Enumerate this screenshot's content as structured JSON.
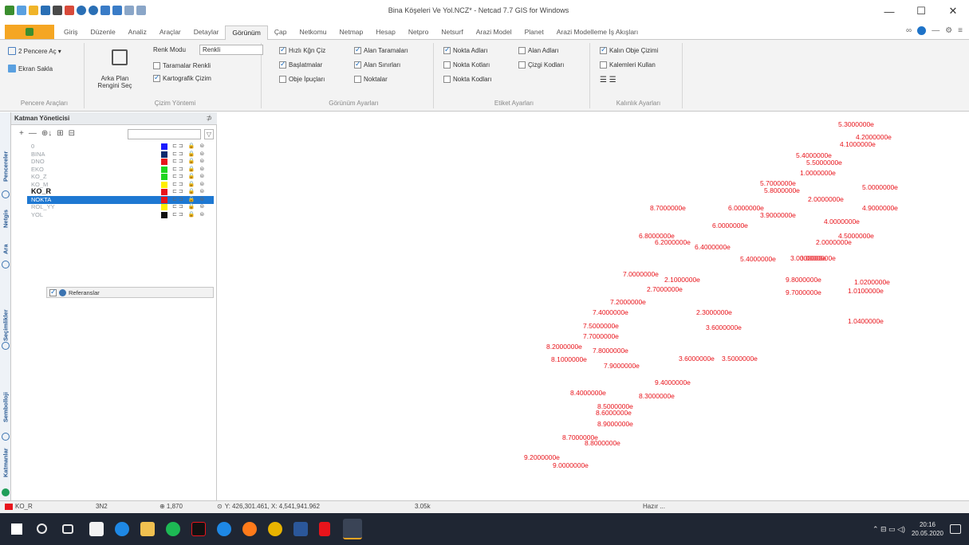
{
  "window": {
    "title": "Bina Köşeleri Ve Yol.NCZ* - Netcad 7.7 GIS for Windows",
    "minimize": "—",
    "maximize": "☐",
    "close": "✕"
  },
  "tabs": [
    "Giriş",
    "Düzenle",
    "Analiz",
    "Araçlar",
    "Detaylar",
    "Görünüm",
    "Çap",
    "Netkomu",
    "Netmap",
    "Hesap",
    "Netpro",
    "Netsurf",
    "Arazi Model",
    "Planet",
    "Arazi Modelleme İş Akışları"
  ],
  "active_tab": "Görünüm",
  "ribbon": {
    "pencere": {
      "label": "Pencere Araçları",
      "ikipencere": "2 Pencere Aç ▾",
      "ekransakla": "Ekran Sakla"
    },
    "cizim": {
      "label": "Çizim Yöntemi",
      "arkaplan": "Arka Plan Rengini Seç",
      "renkmodu_label": "Renk Modu",
      "renkmodu_value": "Renkli",
      "taramalar": "Taramalar Renkli",
      "kartografik": "Kartografik Çizim"
    },
    "gorunum": {
      "label": "Görünüm Ayarları",
      "hizli": "Hızlı Kğn Çiz",
      "baslatmalar": "Başlatmalar",
      "obje": "Obje İpuçları",
      "alantaramalari": "Alan Taramaları",
      "alansinirlari": "Alan Sınırları",
      "noktalar": "Noktalar"
    },
    "etiket": {
      "label": "Etiket Ayarları",
      "noktaadlari": "Nokta Adları",
      "noktakotlari": "Nokta Kotları",
      "noktakodlari": "Nokta Kodları",
      "alanadlari": "Alan Adları",
      "cizgikodlari": "Çizgi Kodları"
    },
    "kalinlik": {
      "label": "Kalınlık Ayarları",
      "kalinobje": "Kalın Obje Çizimi",
      "kalemleri": "Kalemleri Kullan",
      "icons": "☰ ☰"
    }
  },
  "layers_panel": {
    "title": "Katman Yöneticisi",
    "pin": "⊅",
    "filter": "▽",
    "toolbar": [
      "+",
      "—",
      "⊕↓",
      "⊞",
      "⊟"
    ],
    "layers": [
      {
        "name": "0",
        "color": "#1a1aff",
        "style": "normal"
      },
      {
        "name": "BINA",
        "color": "#0a2a6e",
        "style": "normal"
      },
      {
        "name": "DNO",
        "color": "#e8141b",
        "style": "normal"
      },
      {
        "name": "EKO",
        "color": "#1fd61f",
        "style": "normal"
      },
      {
        "name": "KO_Z",
        "color": "#1fd61f",
        "style": "normal"
      },
      {
        "name": "KO_M",
        "color": "#ffee00",
        "style": "normal"
      },
      {
        "name": "KO_R",
        "color": "#e8141b",
        "style": "bold"
      },
      {
        "name": "NOKTA",
        "color": "#e8141b",
        "style": "selected"
      },
      {
        "name": "ROL_YY",
        "color": "#ffee00",
        "style": "normal"
      },
      {
        "name": "YOL",
        "color": "#111111",
        "style": "normal"
      }
    ],
    "layer_flags": "⊏⊐ 🔒 ⊜",
    "reference": "Referanslar"
  },
  "side_tabs": [
    "Katmanlar",
    "Sembolloji",
    "Seçimlikler",
    "Ara",
    "Netgis",
    "Pencereler"
  ],
  "status": {
    "layer": "KO_R",
    "mode": "3N2",
    "scale": "⊕ 1,870",
    "coords": "Y: 426,301.461, X: 4,541,941.962",
    "zoom": "3.05k",
    "state": "Hazır ..."
  },
  "taskbar": {
    "time": "20:16",
    "date": "20.05.2020",
    "tray": "⌃  ⊟  ▭  ◁)"
  },
  "map_labels": [
    {
      "t": "5.3000000e"
    },
    {
      "t": "4.2000000e"
    },
    {
      "t": "4.1000000e"
    },
    {
      "t": "5.4000000e"
    },
    {
      "t": "5.5000000e"
    },
    {
      "t": "1.0000000e"
    },
    {
      "t": "5.7000000e"
    },
    {
      "t": "5.8000000e"
    },
    {
      "t": "5.0000000e"
    },
    {
      "t": "2.0000000e"
    },
    {
      "t": "8.7000000e"
    },
    {
      "t": "6.0000000e"
    },
    {
      "t": "4.9000000e"
    },
    {
      "t": "3.9000000e"
    },
    {
      "t": "6.0000000e"
    },
    {
      "t": "4.0000000e"
    },
    {
      "t": "6.8000000e"
    },
    {
      "t": "6.2000000e"
    },
    {
      "t": "2.0000000e"
    },
    {
      "t": "4.5000000e"
    },
    {
      "t": "6.4000000e"
    },
    {
      "t": "3.0000000e"
    },
    {
      "t": "5.4000000e"
    },
    {
      "t": "3.0000000e"
    },
    {
      "t": "7.0000000e"
    },
    {
      "t": "2.1000000e"
    },
    {
      "t": "9.8000000e"
    },
    {
      "t": "1.0200000e"
    },
    {
      "t": "2.7000000e"
    },
    {
      "t": "9.7000000e"
    },
    {
      "t": "1.0100000e"
    },
    {
      "t": "7.2000000e"
    },
    {
      "t": "7.4000000e"
    },
    {
      "t": "2.3000000e"
    },
    {
      "t": "1.0400000e"
    },
    {
      "t": "7.5000000e"
    },
    {
      "t": "3.6000000e"
    },
    {
      "t": "7.7000000e"
    },
    {
      "t": "8.2000000e"
    },
    {
      "t": "7.8000000e"
    },
    {
      "t": "8.1000000e"
    },
    {
      "t": "7.9000000e"
    },
    {
      "t": "3.6000000e"
    },
    {
      "t": "3.5000000e"
    },
    {
      "t": "9.4000000e"
    },
    {
      "t": "8.4000000e"
    },
    {
      "t": "8.3000000e"
    },
    {
      "t": "8.5000000e"
    },
    {
      "t": "8.6000000e"
    },
    {
      "t": "8.9000000e"
    },
    {
      "t": "8.7000000e"
    },
    {
      "t": "8.8000000e"
    },
    {
      "t": "9.2000000e"
    },
    {
      "t": "9.0000000e"
    }
  ]
}
